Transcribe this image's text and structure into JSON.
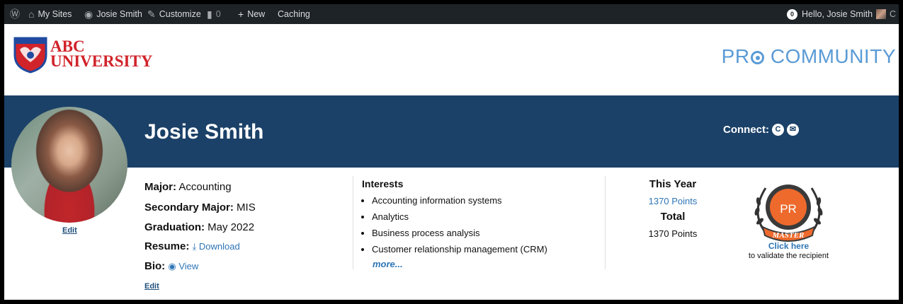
{
  "adminbar": {
    "items": [
      "My Sites",
      "Josie Smith",
      "Customize",
      "0",
      "New",
      "Caching"
    ],
    "notif_count": "0",
    "greeting": "Hello, Josie Smith"
  },
  "header": {
    "logo_line1": "ABC",
    "logo_line2": "UNIVERSITY",
    "brand_pre": "PR",
    "brand_post": " COMMUNITY"
  },
  "profile": {
    "name": "Josie Smith",
    "connect_label": "Connect:",
    "avatar_edit": "Edit",
    "major_label": "Major:",
    "major": "Accounting",
    "secondary_label": "Secondary Major:",
    "secondary": "MIS",
    "graduation_label": "Graduation:",
    "graduation": "May 2022",
    "resume_label": "Resume:",
    "resume_link": "Download",
    "bio_label": "Bio:",
    "bio_link": "View",
    "details_edit": "Edit"
  },
  "interests": {
    "title": "Interests",
    "items": [
      "Accounting information systems",
      "Analytics",
      "Business process analysis",
      "Customer relationship management (CRM)"
    ],
    "more": "more..."
  },
  "points": {
    "this_year_label": "This Year",
    "this_year": "1370 Points",
    "total_label": "Total",
    "total": "1370 Points"
  },
  "badge": {
    "top_text": "PR",
    "ribbon": "MASTER",
    "click_here": "Click here",
    "validate": "to validate the recipient"
  },
  "colors": {
    "banner": "#1b4168",
    "brand": "#5b9bd5",
    "logo_red": "#d1232a",
    "link": "#2e75b6",
    "badge_orange": "#ee6a2c"
  }
}
